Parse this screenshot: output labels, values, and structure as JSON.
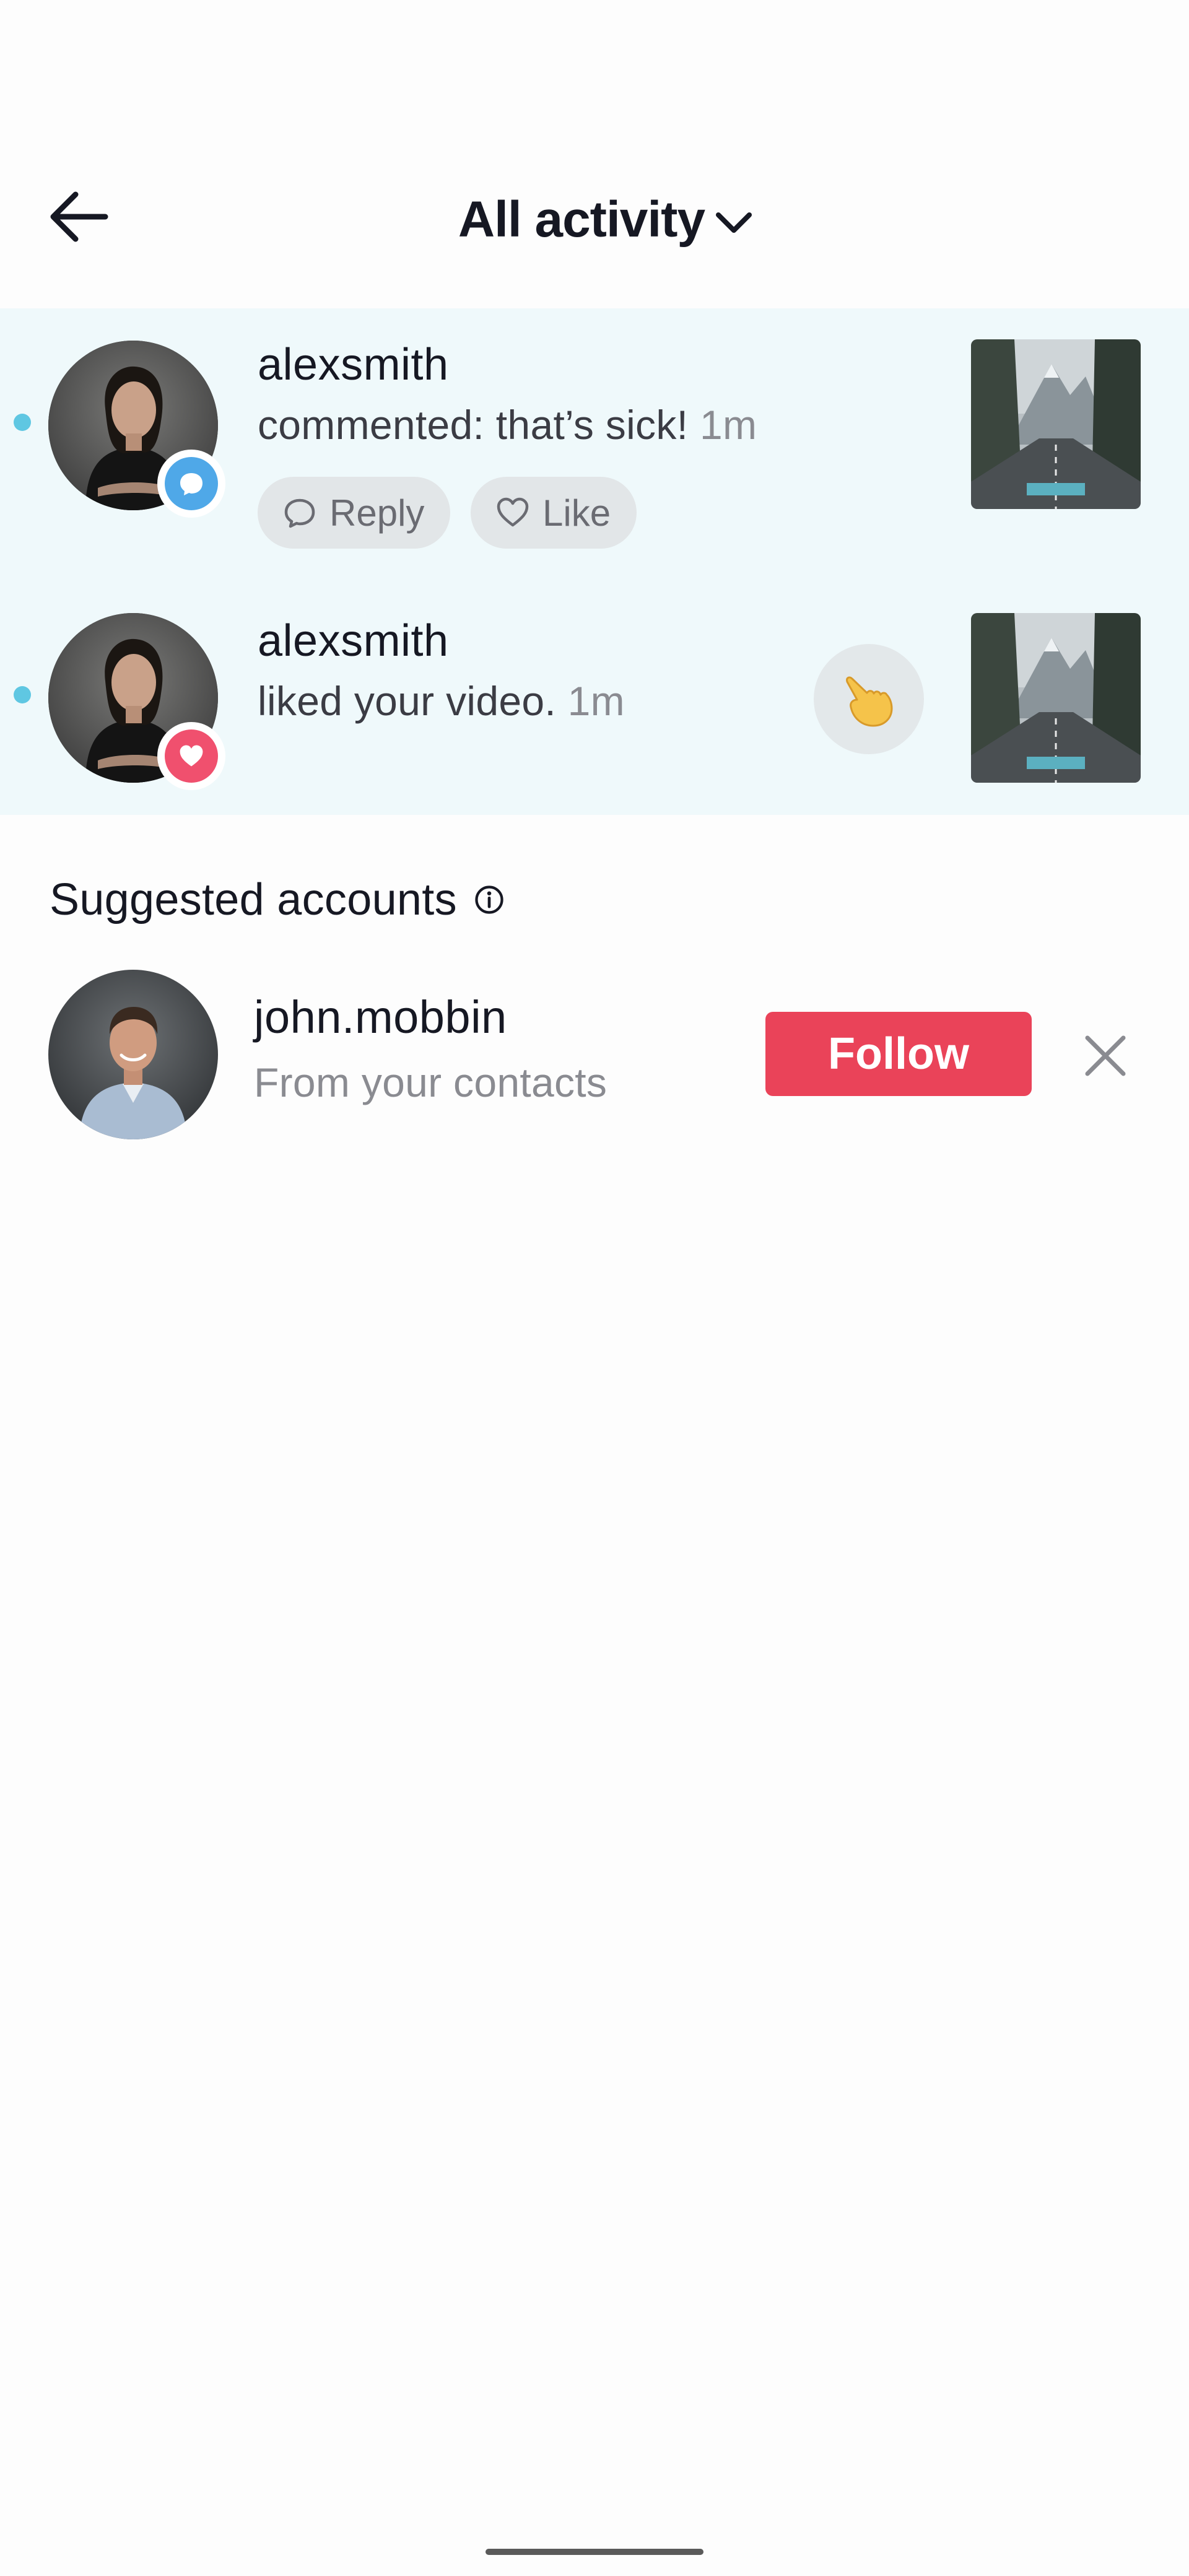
{
  "header": {
    "title": "All activity",
    "back_icon": "arrow-left-icon",
    "dropdown_icon": "chevron-down-icon"
  },
  "notifications": [
    {
      "username": "alexsmith",
      "action": "commented: that’s sick!",
      "time": "1m",
      "badge_icon": "comment-icon",
      "badge_color": "#4fa8e8",
      "unread": true,
      "buttons": {
        "reply": "Reply",
        "like": "Like"
      }
    },
    {
      "username": "alexsmith",
      "action": "liked your video.",
      "time": "1m",
      "badge_icon": "heart-icon",
      "badge_color": "#f0506e",
      "unread": true,
      "react_icon": "pointing-hand-emoji"
    }
  ],
  "suggested": {
    "heading": "Suggested accounts",
    "info_icon": "info-icon",
    "accounts": [
      {
        "username": "john.mobbin",
        "subtitle": "From your contacts",
        "follow_label": "Follow",
        "dismiss_icon": "close-icon"
      }
    ]
  },
  "colors": {
    "accent": "#ea4359",
    "unread_bg": "#eff9fb",
    "unread_dot": "#5fc7e2"
  }
}
